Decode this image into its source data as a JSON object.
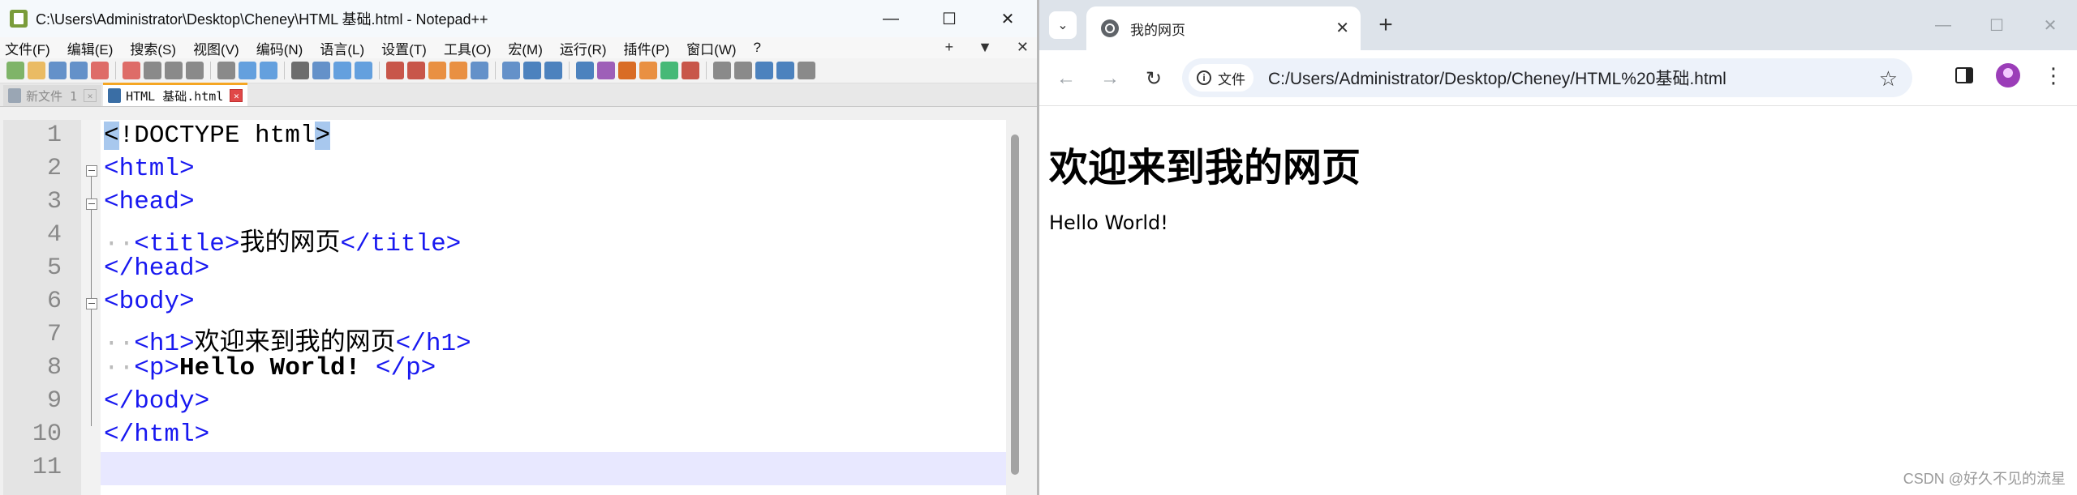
{
  "notepad": {
    "title": "C:\\Users\\Administrator\\Desktop\\Cheney\\HTML 基础.html - Notepad++",
    "window_controls": {
      "minimize": "—",
      "maximize": "☐",
      "close": "✕"
    },
    "menu": [
      "文件(F)",
      "编辑(E)",
      "搜索(S)",
      "视图(V)",
      "编码(N)",
      "语言(L)",
      "设置(T)",
      "工具(O)",
      "宏(M)",
      "运行(R)",
      "插件(P)",
      "窗口(W)",
      "?"
    ],
    "menu_right": {
      "plus": "+",
      "dropdown": "▼",
      "close": "✕"
    },
    "tabs": [
      {
        "label": "新文件 1",
        "active": false
      },
      {
        "label": "HTML 基础.html",
        "active": true
      }
    ],
    "tab_close": "✕",
    "lines": [
      {
        "num": "1"
      },
      {
        "num": "2"
      },
      {
        "num": "3"
      },
      {
        "num": "4"
      },
      {
        "num": "5"
      },
      {
        "num": "6"
      },
      {
        "num": "7"
      },
      {
        "num": "8"
      },
      {
        "num": "9"
      },
      {
        "num": "10"
      },
      {
        "num": "11"
      }
    ],
    "code": {
      "doctype_lt": "<",
      "doctype_text": "!DOCTYPE html",
      "doctype_gt": ">",
      "html_open": "<html>",
      "head_open": "<head>",
      "title_open": "<title>",
      "title_text": "我的网页",
      "title_close": "</title>",
      "head_close": "</head>",
      "body_open": "<body>",
      "h1_open": "<h1>",
      "h1_text": "欢迎来到我的网页",
      "h1_close": "</h1>",
      "p_open": "<p>",
      "p_text": "Hello World! ",
      "p_close": "</p>",
      "body_close": "</body>",
      "html_close": "</html>",
      "indent": "··"
    },
    "toolbar_colors": [
      "#6aa84f",
      "#e8b04a",
      "#4a7fc1",
      "#4a7fc1",
      "#d9534f",
      "#d9534f",
      "#777777",
      "#777777",
      "#777777",
      "#777777",
      "#4a90d9",
      "#4a90d9",
      "#555555",
      "#4a7fc1",
      "#4a90d9",
      "#4a90d9",
      "#c0392b",
      "#c0392b",
      "#e67e22",
      "#e67e22",
      "#4a7fc1",
      "#4a7fc1",
      "#2e6db4",
      "#2e6db4",
      "#2e6db4",
      "#8e44ad",
      "#d35400",
      "#e67e22",
      "#27ae60",
      "#c0392b",
      "#777777",
      "#777777",
      "#2e6db4",
      "#2e6db4",
      "#777777"
    ]
  },
  "chrome": {
    "tab_title": "我的网页",
    "tab_close": "✕",
    "new_tab": "+",
    "tab_search": "⌄",
    "window_controls": {
      "minimize": "—",
      "maximize": "☐",
      "close": "✕"
    },
    "nav": {
      "back": "←",
      "forward": "→",
      "reload": "↻"
    },
    "secure_label": "文件",
    "info_glyph": "i",
    "url": "C:/Users/Administrator/Desktop/Cheney/HTML%20基础.html",
    "star": "☆",
    "menu_glyph": "⋮",
    "page": {
      "h1": "欢迎来到我的网页",
      "p": "Hello World!"
    },
    "watermark": "CSDN @好久不见的流星"
  }
}
